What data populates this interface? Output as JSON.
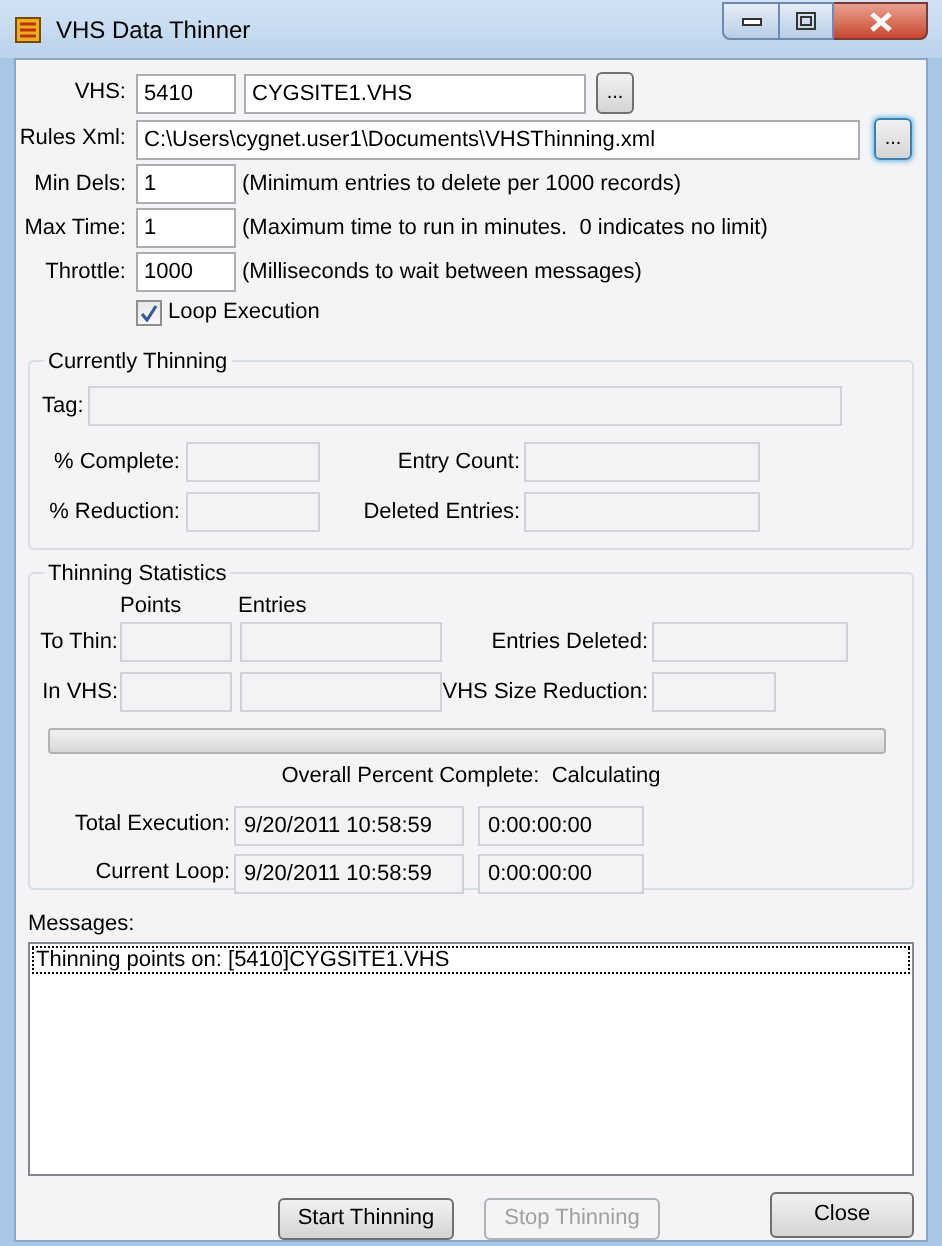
{
  "window": {
    "title": "VHS Data Thinner"
  },
  "vhs": {
    "label": "VHS:",
    "site": "5410",
    "file": "CYGSITE1.VHS",
    "browse": {
      "label": "...",
      "focused": false
    }
  },
  "rules_xml": {
    "label": "Rules Xml:",
    "value": "C:\\Users\\cygnet.user1\\Documents\\VHSThinning.xml",
    "browse": {
      "label": "...",
      "focused": true
    }
  },
  "options": [
    {
      "label": "Min Dels:",
      "value": "1",
      "hint": "(Minimum entries to delete per 1000 records)"
    },
    {
      "label": "Max Time:",
      "value": "1",
      "hint": "(Maximum time to run in minutes.  0 indicates no limit)"
    },
    {
      "label": "Throttle:",
      "value": "1000",
      "hint": "(Milliseconds to wait between messages)"
    }
  ],
  "loop_execution": {
    "label": "Loop Execution",
    "checked": true
  },
  "currently_thinning": {
    "title": "Currently Thinning",
    "tag_label": "Tag:",
    "percent_complete_label": "% Complete:",
    "entry_count_label": "Entry Count:",
    "percent_reduction_label": "% Reduction:",
    "deleted_entries_label": "Deleted Entries:"
  },
  "thinning_statistics": {
    "title": "Thinning Statistics",
    "points_header": "Points",
    "entries_header": "Entries",
    "to_thin_label": "To Thin:",
    "entries_deleted_label": "Entries Deleted:",
    "in_vhs_label": "In VHS:",
    "vhs_size_reduction_label": "VHS Size Reduction:",
    "progress": {
      "level": 0
    },
    "overall": "Overall Percent Complete:  Calculating",
    "timings": [
      {
        "label": "Total Execution:",
        "start": "9/20/2011 10:58:59",
        "elapsed": "0:00:00:00"
      },
      {
        "label": "Current Loop:",
        "start": "9/20/2011 10:58:59",
        "elapsed": "0:00:00:00"
      }
    ]
  },
  "messages": {
    "label": "Messages:",
    "items": [
      {
        "text": "Thinning points on: [5410]CYGSITE1.VHS",
        "focused": true
      }
    ]
  },
  "buttons": [
    {
      "label": "Start Thinning",
      "disabled": false
    },
    {
      "label": "Stop Thinning",
      "disabled": true
    }
  ],
  "close_button": {
    "label": "Close"
  }
}
